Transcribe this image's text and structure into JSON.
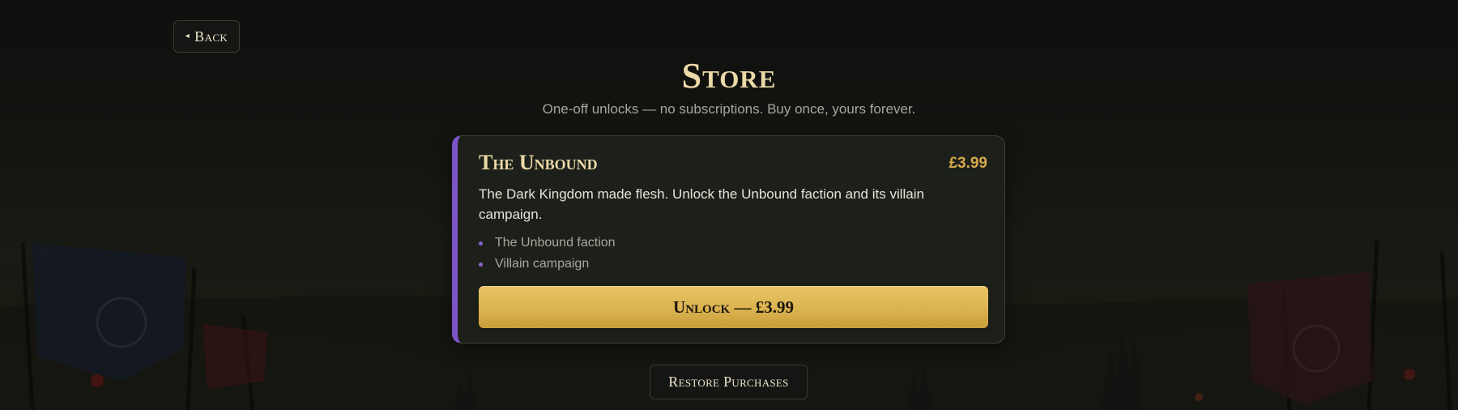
{
  "navigation": {
    "back_icon": "triangle-left-icon",
    "back_icon_glyph": "◂",
    "back_label": "Back"
  },
  "header": {
    "title": "Store",
    "subtitle": "One-off unlocks — no subscriptions. Buy once, yours forever."
  },
  "products": [
    {
      "title": "The Unbound",
      "price": "£3.99",
      "description": "The Dark Kingdom made flesh. Unlock the Unbound faction and its villain campaign.",
      "features": [
        "The Unbound faction",
        "Villain campaign"
      ],
      "button_label": "Unlock — £3.99",
      "accent_color": "#7d54c8"
    }
  ],
  "footer": {
    "restore_label": "Restore Purchases"
  },
  "theme": {
    "title_color": "#ecd9a8",
    "price_color": "#d6a84a",
    "button_gold": "#dcb552",
    "background": "#131410"
  }
}
